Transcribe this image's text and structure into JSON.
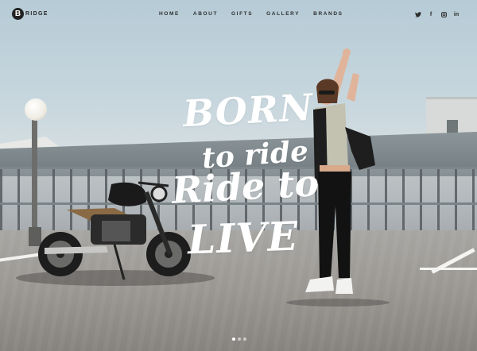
{
  "brand": {
    "badge": "B",
    "name": "RIDGE"
  },
  "nav": {
    "items": [
      {
        "label": "HOME"
      },
      {
        "label": "ABOUT"
      },
      {
        "label": "GIFTS"
      },
      {
        "label": "GALLERY"
      },
      {
        "label": "BRANDS"
      }
    ]
  },
  "social": {
    "icons": [
      {
        "name": "twitter-icon",
        "glyph": "🐦"
      },
      {
        "name": "facebook-icon",
        "glyph": "f"
      },
      {
        "name": "instagram-icon",
        "glyph": "▣"
      },
      {
        "name": "linkedin-icon",
        "glyph": "in"
      }
    ]
  },
  "hero": {
    "line1": "BORN",
    "line2": "to ride",
    "line3": "Ride to",
    "line4": "LIVE"
  },
  "slider": {
    "count": 3,
    "active_index": 0
  },
  "colors": {
    "text_dark": "#2a2a2a",
    "headline": "#ffffff",
    "sky": "#b6cbd6"
  }
}
